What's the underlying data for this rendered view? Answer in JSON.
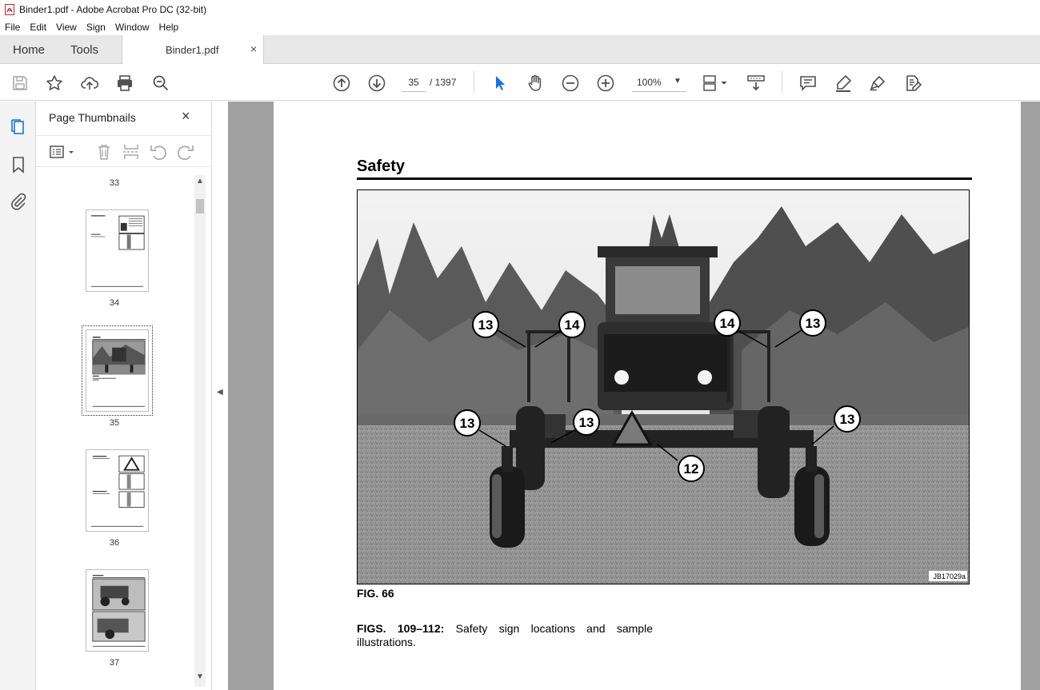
{
  "window": {
    "title": "Binder1.pdf - Adobe Acrobat Pro DC (32-bit)"
  },
  "menu": [
    "File",
    "Edit",
    "View",
    "Sign",
    "Window",
    "Help"
  ],
  "tabs": {
    "home": "Home",
    "tools": "Tools",
    "document": "Binder1.pdf",
    "close_glyph": "×"
  },
  "toolbar": {
    "current_page": "35",
    "page_total": "/ 1397",
    "zoom": "100%"
  },
  "thumbnails_panel": {
    "title": "Page Thumbnails",
    "pages": [
      {
        "number": "33"
      },
      {
        "number": "34"
      },
      {
        "number": "35",
        "selected": true
      },
      {
        "number": "36"
      },
      {
        "number": "37"
      }
    ]
  },
  "document": {
    "heading": "Safety",
    "callouts": [
      "13",
      "14",
      "14",
      "13",
      "13",
      "13",
      "13",
      "12"
    ],
    "image_code": "JB17029a",
    "figure_label": "FIG. 66",
    "caption_bold": "FIGS. 109–112:",
    "caption_text": " Safety sign locations and sample illustrations."
  },
  "colors": {
    "accent": "#1473e6",
    "icon": "#505050",
    "canvas": "#a0a0a0",
    "pdf_red": "#d4202a"
  }
}
